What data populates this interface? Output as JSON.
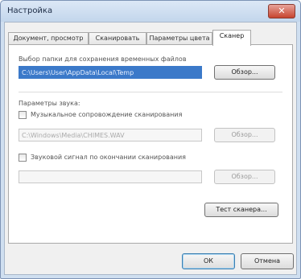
{
  "window": {
    "title": "Настройка",
    "close_glyph": "✕"
  },
  "tabs": [
    {
      "label": "Документ, просмотр"
    },
    {
      "label": "Сканировать"
    },
    {
      "label": "Параметры цвета"
    },
    {
      "label": "Сканер"
    }
  ],
  "scanner": {
    "temp_folder_label": "Выбор папки для сохранения временных файлов",
    "temp_folder_value": "C:\\Users\\User\\AppData\\Local\\Temp",
    "browse_label": "Обзор...",
    "sound_group_label": "Параметры звука:",
    "music_checkbox_label": "Музыкальное сопровождение сканирования",
    "music_checked": false,
    "music_path": "C:\\Windows\\Media\\CHIMES.WAV",
    "end_sound_checkbox_label": "Звуковой сигнал по окончании сканирования",
    "end_sound_checked": false,
    "end_sound_path": "",
    "test_button_label": "Тест сканера..."
  },
  "footer": {
    "ok_label": "ОК",
    "cancel_label": "Отмена"
  },
  "colors": {
    "selection": "#3b79c9",
    "title_bar": "#cfdff0",
    "close": "#c7442f"
  }
}
